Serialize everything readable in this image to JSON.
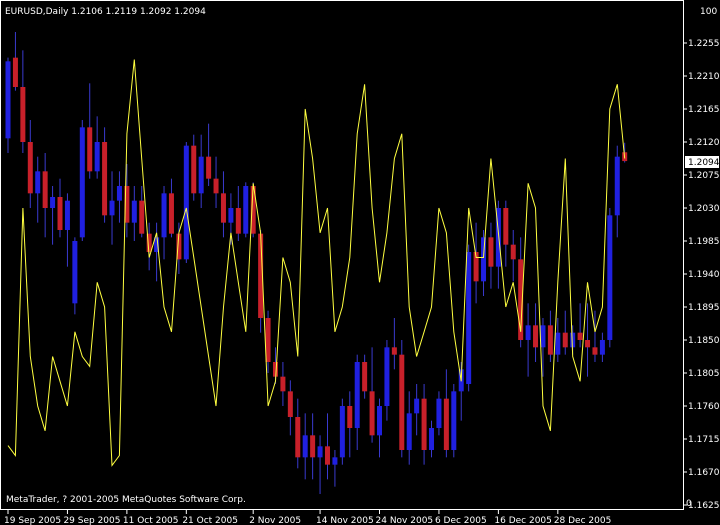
{
  "header": {
    "symbol_info": "EURUSD,Daily  1.2106 1.2119 1.2092 1.2094"
  },
  "footer": {
    "copyright": "MetaTrader, ? 2001-2005 MetaQuotes Software Corp."
  },
  "colors": {
    "background": "#000000",
    "bull_candle": "#2020E0",
    "bear_candle": "#C8202A",
    "wick": "#3A3ACF",
    "indicator_line": "#FFFF40",
    "axis": "#FFFFFF"
  },
  "chart_data": {
    "type": "candlestick",
    "symbol": "EURUSD",
    "timeframe": "Daily",
    "last_bar": {
      "open": 1.2106,
      "high": 1.2119,
      "low": 1.2092,
      "close": 1.2094
    },
    "current_price_label": "1.2094",
    "ylim": [
      1.1625,
      1.23
    ],
    "y_ticks": [
      "1.2255",
      "1.2210",
      "1.2165",
      "1.2120",
      "1.2075",
      "1.2030",
      "1.1985",
      "1.1940",
      "1.1895",
      "1.1850",
      "1.1805",
      "1.1760",
      "1.1715",
      "1.1670",
      "1.1625"
    ],
    "oscillator_scale": {
      "top": "100",
      "bottom": "0"
    },
    "x_ticks": [
      "19 Sep 2005",
      "29 Sep 2005",
      "11 Oct 2005",
      "21 Oct 2005",
      "2 Nov 2005",
      "14 Nov 2005",
      "24 Nov 2005",
      "6 Dec 2005",
      "16 Dec 2005",
      "28 Dec 2005"
    ],
    "x_tick_bar_index": [
      0,
      8,
      16,
      24,
      33,
      42,
      50,
      58,
      66,
      74
    ],
    "ohlc": [
      [
        1.2125,
        1.2235,
        1.2105,
        1.223
      ],
      [
        1.2235,
        1.227,
        1.219,
        1.2195
      ],
      [
        1.2195,
        1.2245,
        1.2105,
        1.212
      ],
      [
        1.212,
        1.215,
        1.203,
        1.205
      ],
      [
        1.205,
        1.21,
        1.201,
        1.208
      ],
      [
        1.208,
        1.2105,
        1.199,
        1.203
      ],
      [
        1.203,
        1.206,
        1.198,
        1.2045
      ],
      [
        1.2045,
        1.207,
        1.199,
        1.2
      ],
      [
        1.2,
        1.205,
        1.195,
        1.204
      ],
      [
        1.19,
        1.199,
        1.1885,
        1.1985
      ],
      [
        1.199,
        1.215,
        1.1985,
        1.214
      ],
      [
        1.214,
        1.22,
        1.207,
        1.208
      ],
      [
        1.208,
        1.2155,
        1.207,
        1.212
      ],
      [
        1.212,
        1.214,
        1.201,
        1.202
      ],
      [
        1.202,
        1.208,
        1.198,
        1.204
      ],
      [
        1.204,
        1.208,
        1.201,
        1.206
      ],
      [
        1.206,
        1.209,
        1.199,
        1.201
      ],
      [
        1.201,
        1.206,
        1.1985,
        1.204
      ],
      [
        1.204,
        1.206,
        1.199,
        1.1995
      ],
      [
        1.1995,
        1.201,
        1.1945,
        1.197
      ],
      [
        1.197,
        1.201,
        1.193,
        1.199
      ],
      [
        1.199,
        1.206,
        1.196,
        1.205
      ],
      [
        1.205,
        1.207,
        1.199,
        1.1995
      ],
      [
        1.1995,
        1.201,
        1.194,
        1.196
      ],
      [
        1.196,
        1.212,
        1.1955,
        1.2115
      ],
      [
        1.2115,
        1.213,
        1.204,
        1.205
      ],
      [
        1.205,
        1.213,
        1.203,
        1.21
      ],
      [
        1.21,
        1.2145,
        1.206,
        1.207
      ],
      [
        1.207,
        1.21,
        1.203,
        1.205
      ],
      [
        1.205,
        1.208,
        1.199,
        1.201
      ],
      [
        1.201,
        1.205,
        1.198,
        1.203
      ],
      [
        1.203,
        1.206,
        1.1985,
        1.1995
      ],
      [
        1.1995,
        1.2065,
        1.199,
        1.206
      ],
      [
        1.206,
        1.2065,
        1.199,
        1.1995
      ],
      [
        1.1995,
        1.2,
        1.186,
        1.188
      ],
      [
        1.188,
        1.189,
        1.1805,
        1.182
      ],
      [
        1.182,
        1.184,
        1.179,
        1.18
      ],
      [
        1.18,
        1.182,
        1.176,
        1.178
      ],
      [
        1.178,
        1.1795,
        1.172,
        1.1745
      ],
      [
        1.1745,
        1.177,
        1.1675,
        1.169
      ],
      [
        1.169,
        1.175,
        1.166,
        1.172
      ],
      [
        1.172,
        1.175,
        1.166,
        1.169
      ],
      [
        1.169,
        1.172,
        1.164,
        1.1705
      ],
      [
        1.1705,
        1.175,
        1.166,
        1.168
      ],
      [
        1.168,
        1.17,
        1.165,
        1.169
      ],
      [
        1.169,
        1.177,
        1.168,
        1.176
      ],
      [
        1.176,
        1.178,
        1.169,
        1.173
      ],
      [
        1.173,
        1.183,
        1.17,
        1.182
      ],
      [
        1.182,
        1.183,
        1.177,
        1.178
      ],
      [
        1.178,
        1.184,
        1.171,
        1.172
      ],
      [
        1.172,
        1.177,
        1.169,
        1.176
      ],
      [
        1.176,
        1.185,
        1.174,
        1.184
      ],
      [
        1.184,
        1.188,
        1.181,
        1.183
      ],
      [
        1.183,
        1.185,
        1.169,
        1.17
      ],
      [
        1.17,
        1.178,
        1.168,
        1.175
      ],
      [
        1.175,
        1.179,
        1.172,
        1.177
      ],
      [
        1.177,
        1.179,
        1.168,
        1.17
      ],
      [
        1.17,
        1.174,
        1.169,
        1.173
      ],
      [
        1.173,
        1.178,
        1.172,
        1.177
      ],
      [
        1.177,
        1.181,
        1.169,
        1.17
      ],
      [
        1.17,
        1.179,
        1.169,
        1.178
      ],
      [
        1.178,
        1.182,
        1.174,
        1.181
      ],
      [
        1.179,
        1.198,
        1.178,
        1.197
      ],
      [
        1.197,
        1.201,
        1.19,
        1.193
      ],
      [
        1.193,
        1.2,
        1.191,
        1.199
      ],
      [
        1.199,
        1.201,
        1.192,
        1.195
      ],
      [
        1.195,
        1.204,
        1.192,
        1.203
      ],
      [
        1.203,
        1.204,
        1.195,
        1.198
      ],
      [
        1.198,
        1.2,
        1.193,
        1.196
      ],
      [
        1.196,
        1.199,
        1.184,
        1.185
      ],
      [
        1.185,
        1.19,
        1.18,
        1.187
      ],
      [
        1.187,
        1.19,
        1.182,
        1.184
      ],
      [
        1.184,
        1.188,
        1.18,
        1.187
      ],
      [
        1.187,
        1.189,
        1.182,
        1.183
      ],
      [
        1.183,
        1.188,
        1.182,
        1.186
      ],
      [
        1.186,
        1.189,
        1.183,
        1.184
      ],
      [
        1.184,
        1.187,
        1.183,
        1.186
      ],
      [
        1.186,
        1.19,
        1.184,
        1.185
      ],
      [
        1.185,
        1.19,
        1.18,
        1.184
      ],
      [
        1.184,
        1.189,
        1.182,
        1.183
      ],
      [
        1.183,
        1.186,
        1.182,
        1.185
      ],
      [
        1.185,
        1.203,
        1.184,
        1.202
      ],
      [
        1.202,
        1.2115,
        1.199,
        1.21
      ],
      [
        1.2106,
        1.2119,
        1.2092,
        1.2094
      ]
    ],
    "indicator": {
      "name": "",
      "range": [
        0,
        100
      ],
      "values": [
        12,
        10,
        60,
        30,
        20,
        15,
        30,
        25,
        20,
        35,
        30,
        28,
        45,
        40,
        8,
        10,
        75,
        90,
        70,
        50,
        55,
        40,
        35,
        55,
        60,
        50,
        40,
        30,
        20,
        40,
        55,
        45,
        35,
        65,
        55,
        20,
        25,
        50,
        45,
        30,
        80,
        70,
        55,
        60,
        35,
        40,
        50,
        75,
        85,
        60,
        45,
        55,
        70,
        75,
        40,
        30,
        35,
        40,
        60,
        55,
        35,
        25,
        60,
        50,
        50,
        70,
        55,
        40,
        45,
        35,
        65,
        60,
        20,
        15,
        45,
        70,
        30,
        25,
        45,
        35,
        40,
        80,
        85,
        70
      ]
    }
  }
}
